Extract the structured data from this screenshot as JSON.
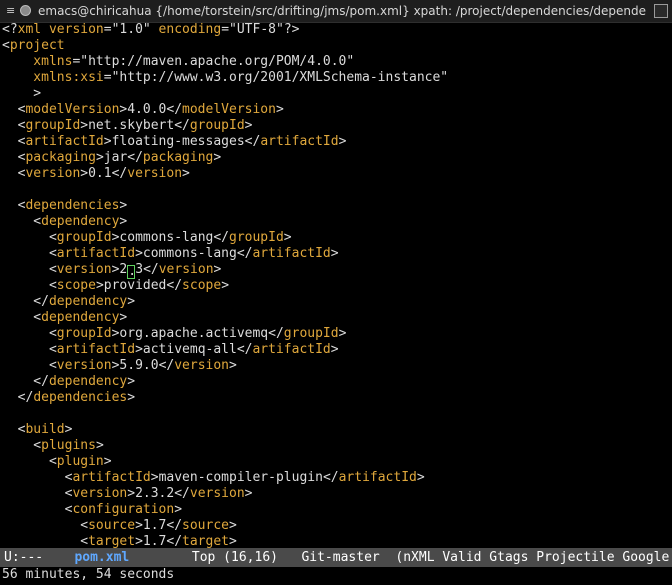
{
  "window": {
    "title": "emacs@chiricahua {/home/torstein/src/drifting/jms/pom.xml} xpath: /project/dependencies/depende"
  },
  "buffer": {
    "lines": [
      [
        [
          "br",
          "<?"
        ],
        [
          "tg",
          "xml"
        ],
        [
          "atn",
          " version"
        ],
        [
          "br",
          "="
        ],
        [
          "atv",
          "\"1.0\""
        ],
        [
          "atn",
          " encoding"
        ],
        [
          "br",
          "="
        ],
        [
          "atv",
          "\"UTF-8\""
        ],
        [
          "br",
          "?>"
        ]
      ],
      [
        [
          "br",
          "<"
        ],
        [
          "tg",
          "project"
        ]
      ],
      [
        [
          "atn",
          "    xmlns"
        ],
        [
          "br",
          "="
        ],
        [
          "atv",
          "\"http://maven.apache.org/POM/4.0.0\""
        ]
      ],
      [
        [
          "atn",
          "    xmlns:xsi"
        ],
        [
          "br",
          "="
        ],
        [
          "atv",
          "\"http://www.w3.org/2001/XMLSchema-instance\""
        ]
      ],
      [
        [
          "br",
          "    >"
        ]
      ],
      [
        [
          "br",
          "  <"
        ],
        [
          "tg",
          "modelVersion"
        ],
        [
          "br",
          ">"
        ],
        [
          "tx",
          "4.0.0"
        ],
        [
          "br",
          "</"
        ],
        [
          "tg",
          "modelVersion"
        ],
        [
          "br",
          ">"
        ]
      ],
      [
        [
          "br",
          "  <"
        ],
        [
          "tg",
          "groupId"
        ],
        [
          "br",
          ">"
        ],
        [
          "tx",
          "net.skybert"
        ],
        [
          "br",
          "</"
        ],
        [
          "tg",
          "groupId"
        ],
        [
          "br",
          ">"
        ]
      ],
      [
        [
          "br",
          "  <"
        ],
        [
          "tg",
          "artifactId"
        ],
        [
          "br",
          ">"
        ],
        [
          "tx",
          "floating-messages"
        ],
        [
          "br",
          "</"
        ],
        [
          "tg",
          "artifactId"
        ],
        [
          "br",
          ">"
        ]
      ],
      [
        [
          "br",
          "  <"
        ],
        [
          "tg",
          "packaging"
        ],
        [
          "br",
          ">"
        ],
        [
          "tx",
          "jar"
        ],
        [
          "br",
          "</"
        ],
        [
          "tg",
          "packaging"
        ],
        [
          "br",
          ">"
        ]
      ],
      [
        [
          "br",
          "  <"
        ],
        [
          "tg",
          "version"
        ],
        [
          "br",
          ">"
        ],
        [
          "tx",
          "0.1"
        ],
        [
          "br",
          "</"
        ],
        [
          "tg",
          "version"
        ],
        [
          "br",
          ">"
        ]
      ],
      [],
      [
        [
          "br",
          "  <"
        ],
        [
          "tg",
          "dependencies"
        ],
        [
          "br",
          ">"
        ]
      ],
      [
        [
          "br",
          "    <"
        ],
        [
          "tg",
          "dependency"
        ],
        [
          "br",
          ">"
        ]
      ],
      [
        [
          "br",
          "      <"
        ],
        [
          "tg",
          "groupId"
        ],
        [
          "br",
          ">"
        ],
        [
          "tx",
          "commons-lang"
        ],
        [
          "br",
          "</"
        ],
        [
          "tg",
          "groupId"
        ],
        [
          "br",
          ">"
        ]
      ],
      [
        [
          "br",
          "      <"
        ],
        [
          "tg",
          "artifactId"
        ],
        [
          "br",
          ">"
        ],
        [
          "tx",
          "commons-lang"
        ],
        [
          "br",
          "</"
        ],
        [
          "tg",
          "artifactId"
        ],
        [
          "br",
          ">"
        ]
      ],
      [
        [
          "br",
          "      <"
        ],
        [
          "tg",
          "version"
        ],
        [
          "br",
          ">"
        ],
        [
          "tx",
          "2"
        ],
        [
          "cur",
          "."
        ],
        [
          "tx",
          "3"
        ],
        [
          "br",
          "</"
        ],
        [
          "tg",
          "version"
        ],
        [
          "br",
          ">"
        ]
      ],
      [
        [
          "br",
          "      <"
        ],
        [
          "tg",
          "scope"
        ],
        [
          "br",
          ">"
        ],
        [
          "tx",
          "provided"
        ],
        [
          "br",
          "</"
        ],
        [
          "tg",
          "scope"
        ],
        [
          "br",
          ">"
        ]
      ],
      [
        [
          "br",
          "    </"
        ],
        [
          "tg",
          "dependency"
        ],
        [
          "br",
          ">"
        ]
      ],
      [
        [
          "br",
          "    <"
        ],
        [
          "tg",
          "dependency"
        ],
        [
          "br",
          ">"
        ]
      ],
      [
        [
          "br",
          "      <"
        ],
        [
          "tg",
          "groupId"
        ],
        [
          "br",
          ">"
        ],
        [
          "tx",
          "org.apache.activemq"
        ],
        [
          "br",
          "</"
        ],
        [
          "tg",
          "groupId"
        ],
        [
          "br",
          ">"
        ]
      ],
      [
        [
          "br",
          "      <"
        ],
        [
          "tg",
          "artifactId"
        ],
        [
          "br",
          ">"
        ],
        [
          "tx",
          "activemq-all"
        ],
        [
          "br",
          "</"
        ],
        [
          "tg",
          "artifactId"
        ],
        [
          "br",
          ">"
        ]
      ],
      [
        [
          "br",
          "      <"
        ],
        [
          "tg",
          "version"
        ],
        [
          "br",
          ">"
        ],
        [
          "tx",
          "5.9.0"
        ],
        [
          "br",
          "</"
        ],
        [
          "tg",
          "version"
        ],
        [
          "br",
          ">"
        ]
      ],
      [
        [
          "br",
          "    </"
        ],
        [
          "tg",
          "dependency"
        ],
        [
          "br",
          ">"
        ]
      ],
      [
        [
          "br",
          "  </"
        ],
        [
          "tg",
          "dependencies"
        ],
        [
          "br",
          ">"
        ]
      ],
      [],
      [
        [
          "br",
          "  <"
        ],
        [
          "tg",
          "build"
        ],
        [
          "br",
          ">"
        ]
      ],
      [
        [
          "br",
          "    <"
        ],
        [
          "tg",
          "plugins"
        ],
        [
          "br",
          ">"
        ]
      ],
      [
        [
          "br",
          "      <"
        ],
        [
          "tg",
          "plugin"
        ],
        [
          "br",
          ">"
        ]
      ],
      [
        [
          "br",
          "        <"
        ],
        [
          "tg",
          "artifactId"
        ],
        [
          "br",
          ">"
        ],
        [
          "tx",
          "maven-compiler-plugin"
        ],
        [
          "br",
          "</"
        ],
        [
          "tg",
          "artifactId"
        ],
        [
          "br",
          ">"
        ]
      ],
      [
        [
          "br",
          "        <"
        ],
        [
          "tg",
          "version"
        ],
        [
          "br",
          ">"
        ],
        [
          "tx",
          "2.3.2"
        ],
        [
          "br",
          "</"
        ],
        [
          "tg",
          "version"
        ],
        [
          "br",
          ">"
        ]
      ],
      [
        [
          "br",
          "        <"
        ],
        [
          "tg",
          "configuration"
        ],
        [
          "br",
          ">"
        ]
      ],
      [
        [
          "br",
          "          <"
        ],
        [
          "tg",
          "source"
        ],
        [
          "br",
          ">"
        ],
        [
          "tx",
          "1.7"
        ],
        [
          "br",
          "</"
        ],
        [
          "tg",
          "source"
        ],
        [
          "br",
          ">"
        ]
      ],
      [
        [
          "br",
          "          <"
        ],
        [
          "tg",
          "target"
        ],
        [
          "br",
          ">"
        ],
        [
          "tx",
          "1.7"
        ],
        [
          "br",
          "</"
        ],
        [
          "tg",
          "target"
        ],
        [
          "br",
          ">"
        ]
      ]
    ]
  },
  "modeline": {
    "status": "U:---",
    "buffer_name": "pom.xml",
    "position": "Top (16,16)",
    "vc": "Git-master",
    "modes": "(nXML Valid Gtags Projectile Google"
  },
  "echo_area": {
    "text": "56 minutes, 54 seconds"
  },
  "colors": {
    "tag": "#e0a83c",
    "text": "#dcdcdc",
    "modeline_bg": "#4a4a4a",
    "buffer_name": "#5fa8ff",
    "cursor": "#5fd35f"
  },
  "icons": {
    "window_menu": "menu-icon",
    "app": "emacs-icon",
    "close": "close-icon"
  }
}
